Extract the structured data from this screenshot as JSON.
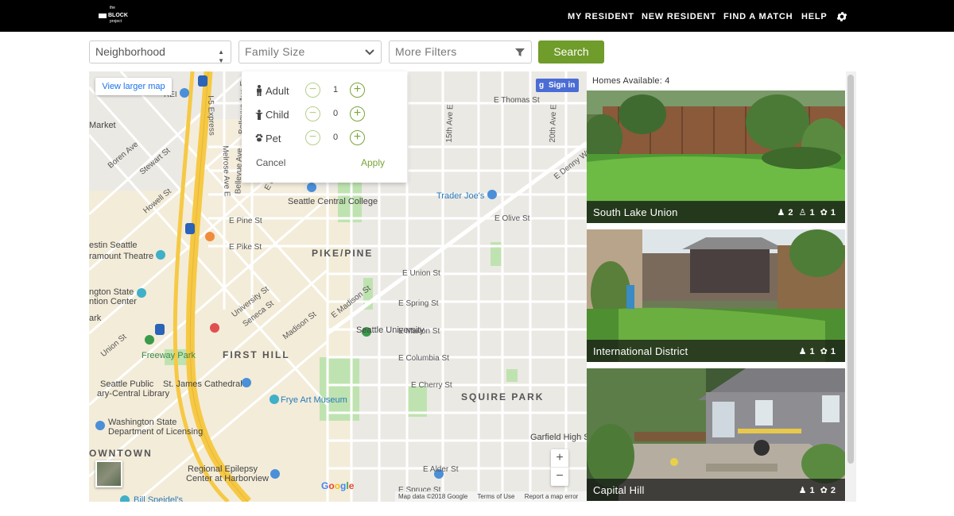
{
  "header": {
    "logo": {
      "line1": "the",
      "line2": "BLOCK",
      "line3": "project"
    },
    "nav": [
      "MY RESIDENT",
      "NEW RESIDENT",
      "FIND A MATCH",
      "HELP"
    ],
    "settings_icon": "gear-icon"
  },
  "filters": {
    "neighborhood": "Neighborhood",
    "family_size": "Family Size",
    "more_filters": "More Filters",
    "search": "Search"
  },
  "family_dropdown": {
    "rows": [
      {
        "label": "Adult",
        "count": "1",
        "icon": "adult-icon"
      },
      {
        "label": "Child",
        "count": "0",
        "icon": "child-icon"
      },
      {
        "label": "Pet",
        "count": "0",
        "icon": "paw-icon"
      }
    ],
    "cancel": "Cancel",
    "apply": "Apply"
  },
  "map": {
    "view_larger": "View larger map",
    "sign_in": "Sign in",
    "zoom_in": "+",
    "zoom_out": "−",
    "watermark": "Google",
    "footer": [
      "Map data ©2018 Google",
      "Terms of Use",
      "Report a map error"
    ],
    "labels": [
      "REI",
      "Market",
      "Boren Ave",
      "Stewart St",
      "Howell St",
      "I-5 Express",
      "Bellevue Ave E",
      "Melrose Ave E",
      "Bellevue Ave",
      "E Olive Way",
      "Seattle Central College",
      "E Pine St",
      "E Pike St",
      "PIKE/PINE",
      "estin Seattle",
      "ramount Theatre",
      "ngton State",
      "ntion Center",
      "ark",
      "Union St",
      "Freeway Park",
      "FIRST HILL",
      "Seattle Public",
      "ary-Central Library",
      "St. James Cathedral",
      "Frye Art Museum",
      "Washington State",
      "Department of Licensing",
      "OWNTOWN",
      "Regional Epilepsy",
      "Center at Harborview",
      "Bill Speidel's",
      "E Thomas St",
      "15th Ave E",
      "20th Ave E",
      "Trader Joe's",
      "E Union St",
      "Seattle University",
      "E Cherry St",
      "SQUIRE PARK",
      "Garfield High S",
      "E Madison St",
      "E Marion St",
      "E Columbia St",
      "E Spring St",
      "E Alder St",
      "E Spruce St",
      "Madison St",
      "Seneca St",
      "University St",
      "E Denny Way",
      "E Olive St"
    ]
  },
  "listings": {
    "caption_prefix": "Homes Available:",
    "count": "4",
    "homes": [
      {
        "name": "South Lake Union",
        "adults": "2",
        "children": "1",
        "pets": "1"
      },
      {
        "name": "International District",
        "adults": "1",
        "children": "",
        "pets": "1"
      },
      {
        "name": "Capital Hill",
        "adults": "1",
        "children": "",
        "pets": "2"
      }
    ]
  },
  "colors": {
    "accent_green": "#6f9c2a",
    "nav_bg": "#000000",
    "map_road_yellow": "#f6c945",
    "map_park": "#bfe3b0"
  }
}
